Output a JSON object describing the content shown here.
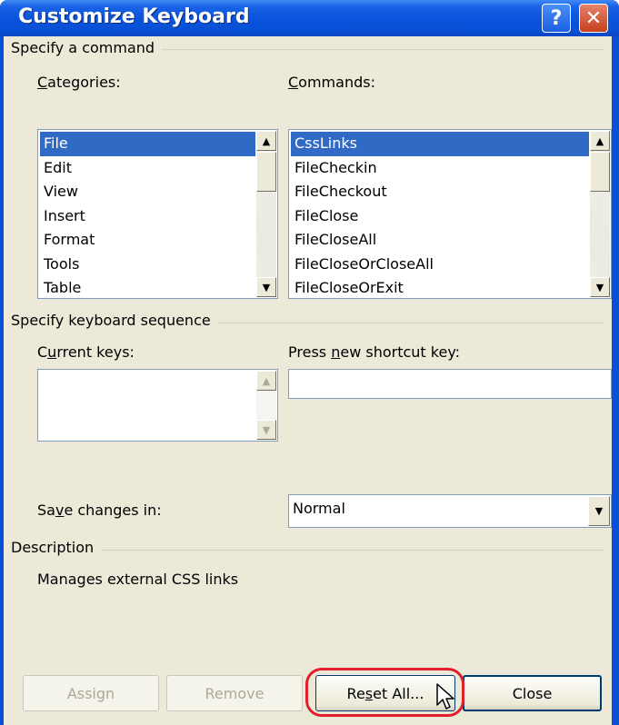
{
  "window": {
    "title": "Customize Keyboard",
    "help_glyph": "?",
    "close_glyph": "✕"
  },
  "command_group": {
    "label": "Specify a command",
    "categories_label_pre": "",
    "categories_label_u": "C",
    "categories_label_post": "ategories:",
    "commands_label_pre": "",
    "commands_label_u": "C",
    "commands_label_post": "ommands:",
    "categories": [
      "File",
      "Edit",
      "View",
      "Insert",
      "Format",
      "Tools",
      "Table"
    ],
    "categories_selected": "File",
    "commands": [
      "CssLinks",
      "FileCheckin",
      "FileCheckout",
      "FileClose",
      "FileCloseAll",
      "FileCloseOrCloseAll",
      "FileCloseOrExit"
    ],
    "commands_selected": "CssLinks"
  },
  "keyboard_group": {
    "label": "Specify keyboard sequence",
    "current_keys_pre": "C",
    "current_keys_u": "u",
    "current_keys_post": "rrent keys:",
    "press_new_pre": "Press ",
    "press_new_u": "n",
    "press_new_post": "ew shortcut key:",
    "new_shortcut_value": "",
    "save_in_pre": "Sa",
    "save_in_u": "v",
    "save_in_post": "e changes in:",
    "save_in_value": "Normal"
  },
  "description_group": {
    "label": "Description",
    "text": "Manages external CSS links"
  },
  "buttons": {
    "assign": "Assign",
    "remove": "Remove",
    "reset_pre": "Re",
    "reset_u": "s",
    "reset_post": "et All...",
    "close": "Close"
  },
  "icons": {
    "scroll_up": "▲",
    "scroll_down": "▼",
    "dropdown": "▼"
  },
  "colors": {
    "title_bar": "#0a54dc",
    "selection": "#316ac5",
    "highlight_ring": "#e0202a",
    "dialog_face": "#ece9d8"
  }
}
